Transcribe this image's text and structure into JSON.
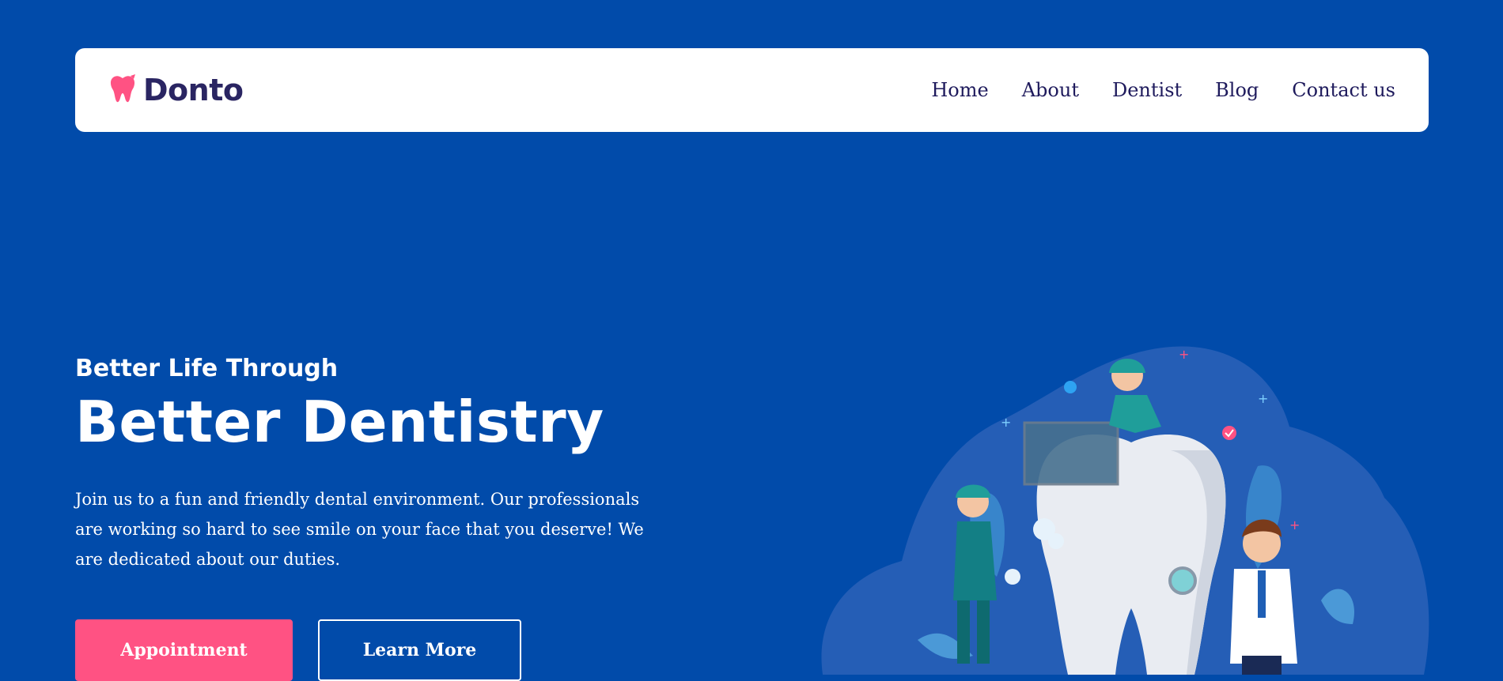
{
  "brand": {
    "name": "Donto",
    "icon": "tooth-icon",
    "icon_color": "#ff5283",
    "text_color": "#2a2562"
  },
  "nav": {
    "items": [
      "Home",
      "About",
      "Dentist",
      "Blog",
      "Contact us"
    ]
  },
  "hero": {
    "eyebrow": "Better Life Through",
    "headline": "Better Dentistry",
    "description": "Join us to a fun and friendly dental environment. Our professionals are working so hard to see smile on your face that you deserve! We are dedicated about our duties.",
    "primary_button": "Appointment",
    "secondary_button": "Learn More"
  },
  "colors": {
    "background": "#014baa",
    "accent": "#ff5283",
    "nav_text": "#1e1a5c"
  },
  "illustration": {
    "icon": "dentist-team-illustration"
  }
}
